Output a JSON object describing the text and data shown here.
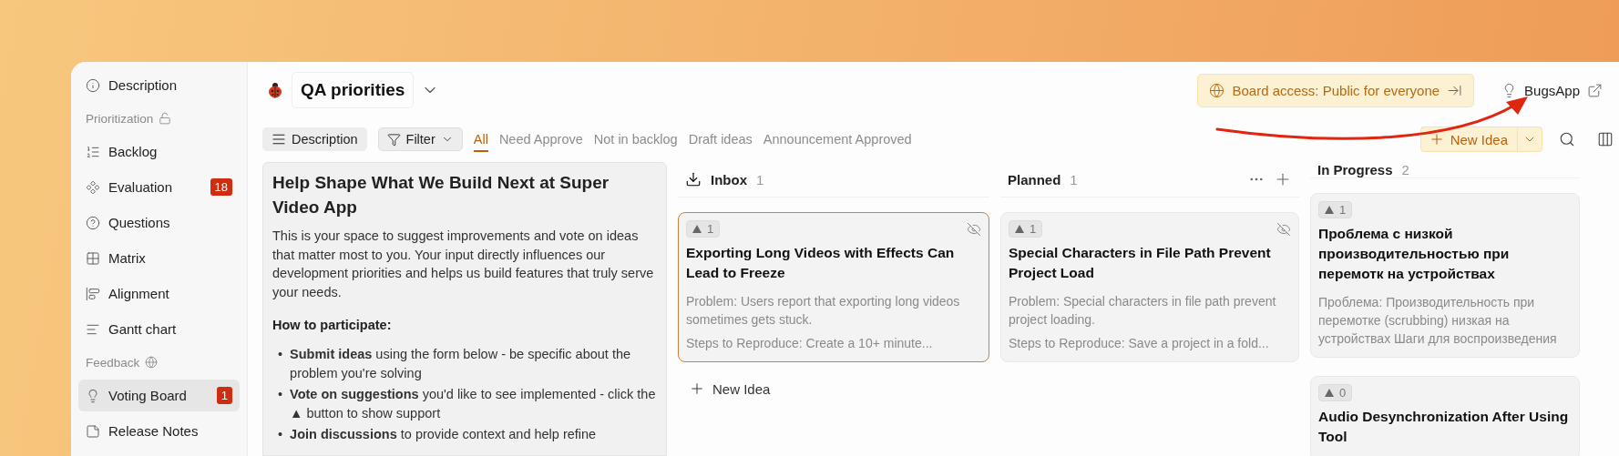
{
  "sidebar": {
    "items": [
      {
        "kind": "item",
        "label": "Description",
        "selected": false
      },
      {
        "kind": "section",
        "label": "Prioritization"
      },
      {
        "kind": "item",
        "label": "Backlog",
        "selected": false
      },
      {
        "kind": "item",
        "label": "Evaluation",
        "badge": "18",
        "selected": false
      },
      {
        "kind": "item",
        "label": "Questions",
        "selected": false
      },
      {
        "kind": "item",
        "label": "Matrix",
        "selected": false
      },
      {
        "kind": "item",
        "label": "Alignment",
        "selected": false
      },
      {
        "kind": "item",
        "label": "Gantt chart",
        "selected": false
      },
      {
        "kind": "section",
        "label": "Feedback"
      },
      {
        "kind": "item",
        "label": "Voting Board",
        "badge": "1",
        "selected": true
      },
      {
        "kind": "item",
        "label": "Release Notes",
        "selected": false
      }
    ]
  },
  "header": {
    "board_title": "QA priorities",
    "access": "Board access: Public for everyone",
    "app_link": "BugsApp"
  },
  "toolbar": {
    "description_button": "Description",
    "filter_button": "Filter",
    "tabs": [
      {
        "label": "All",
        "selected": true
      },
      {
        "label": "Need Approve",
        "selected": false
      },
      {
        "label": "Not in backlog",
        "selected": false
      },
      {
        "label": "Draft ideas",
        "selected": false
      },
      {
        "label": "Announcement Approved",
        "selected": false
      }
    ],
    "new_idea": "New Idea"
  },
  "description": {
    "title": "Help Shape What We Build Next at Super Video App",
    "paragraph": "This is your space to suggest improvements and vote on ideas that matter most to you. Your input directly influences our development priorities and helps us build features that truly serve your needs.",
    "subheading": "How to participate:",
    "bullets": [
      {
        "marker": "•",
        "text": "**Submit ideas** using the form below - be specific about the problem you're solving"
      },
      {
        "marker": "•",
        "text": "**Vote on suggestions** you'd like to see implemented - click the ▲ button to show support"
      },
      {
        "marker": "•",
        "text": "**Join discussions** to provide context and help refine"
      }
    ]
  },
  "columns": [
    {
      "title": "Inbox",
      "count": "1",
      "hovered": false,
      "add_label": "New Idea",
      "cards": [
        {
          "votes": "1",
          "hidden": true,
          "selected": true,
          "title": "Exporting Long Videos with Effects Can Lead to Freeze",
          "body": [
            "Problem: Users report that exporting long videos sometimes gets stuck.",
            "Steps to Reproduce: Create a 10+ minute..."
          ]
        }
      ]
    },
    {
      "title": "Planned",
      "count": "1",
      "hovered": true,
      "cards": [
        {
          "votes": "1",
          "hidden": true,
          "selected": false,
          "title": "Special Characters in File Path Prevent Project Load",
          "body": [
            "Problem: Special characters in file path prevent project loading.",
            "Steps to Reproduce: Save a project in a fold..."
          ]
        }
      ]
    },
    {
      "title": "In Progress",
      "count": "2",
      "hovered": false,
      "cards": [
        {
          "votes": "1",
          "hidden": false,
          "selected": false,
          "title": "Проблема с низкой производительностью при перемотк на устройствах",
          "body": [
            "Проблема: Производительность при перемотке (scrubbing) низкая на устройствах Шаги для воспроизведения"
          ]
        },
        {
          "votes": "0",
          "hidden": false,
          "selected": false,
          "title": "Audio Desynchronization After Using Tool"
        }
      ]
    }
  ]
}
